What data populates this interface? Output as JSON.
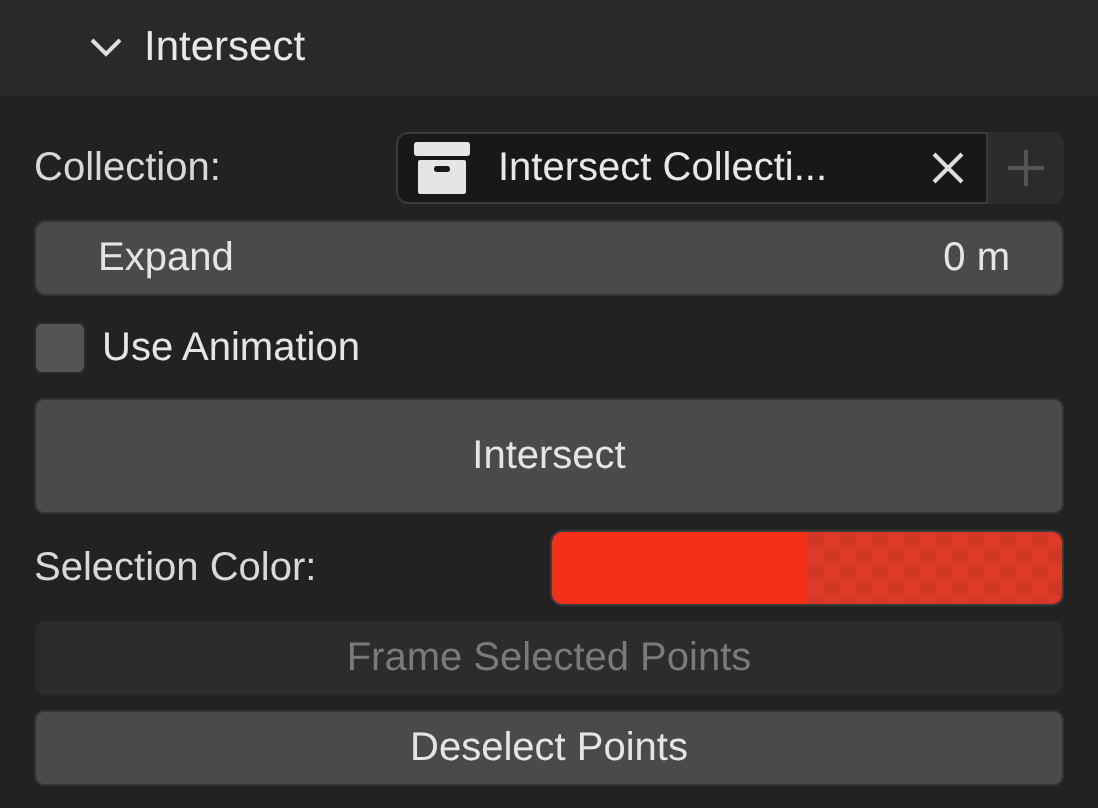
{
  "panel": {
    "title": "Intersect",
    "expanded": true
  },
  "collection": {
    "label": "Collection:",
    "value": "Intersect Collecti..."
  },
  "expand": {
    "label": "Expand",
    "value": "0 m"
  },
  "use_animation": {
    "label": "Use Animation",
    "checked": false
  },
  "intersect_button": {
    "label": "Intersect"
  },
  "selection_color": {
    "label": "Selection Color:",
    "color": "#f43118"
  },
  "buttons": [
    {
      "label": "Frame Selected Points",
      "disabled": true
    },
    {
      "label": "Deselect Points",
      "disabled": false
    }
  ]
}
